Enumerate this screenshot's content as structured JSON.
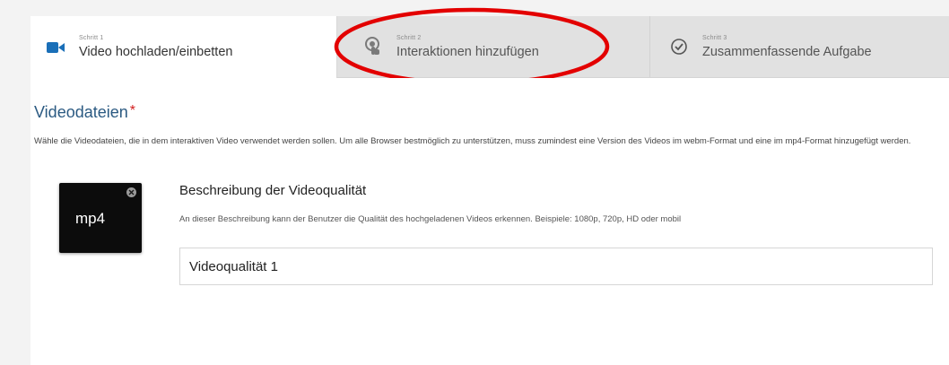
{
  "tabs": [
    {
      "step": "Schritt 1",
      "title": "Video hochladen/einbetten",
      "icon": "video-camera-icon",
      "active": true
    },
    {
      "step": "Schritt 2",
      "title": "Interaktionen hinzufügen",
      "icon": "pointer-hand-icon",
      "active": false
    },
    {
      "step": "Schritt 3",
      "title": "Zusammenfassende Aufgabe",
      "icon": "check-circle-icon",
      "active": false
    }
  ],
  "annotation": {
    "color": "#e30000",
    "shape": "ellipse",
    "target": "tab 2"
  },
  "videofiles": {
    "title": "Videodateien",
    "required_mark": "*",
    "description": "Wähle die Videodateien, die in dem interaktiven Video verwendet werden sollen. Um alle Browser bestmöglich zu unterstützen, muss zumindest eine Version des Videos im webm-Format und eine im mp4-Format hinzugefügt werden."
  },
  "file": {
    "format_label": "mp4"
  },
  "quality": {
    "title": "Beschreibung der Videoqualität",
    "description": "An dieser Beschreibung kann der Benutzer die Qualität des hochgeladenen Videos erkennen. Beispiele: 1080p, 720p, HD oder mobil",
    "value": "Videoqualität 1"
  },
  "colors": {
    "section_title": "#2b5a82",
    "required": "#d21e1e",
    "video_icon": "#1a6fb8"
  }
}
